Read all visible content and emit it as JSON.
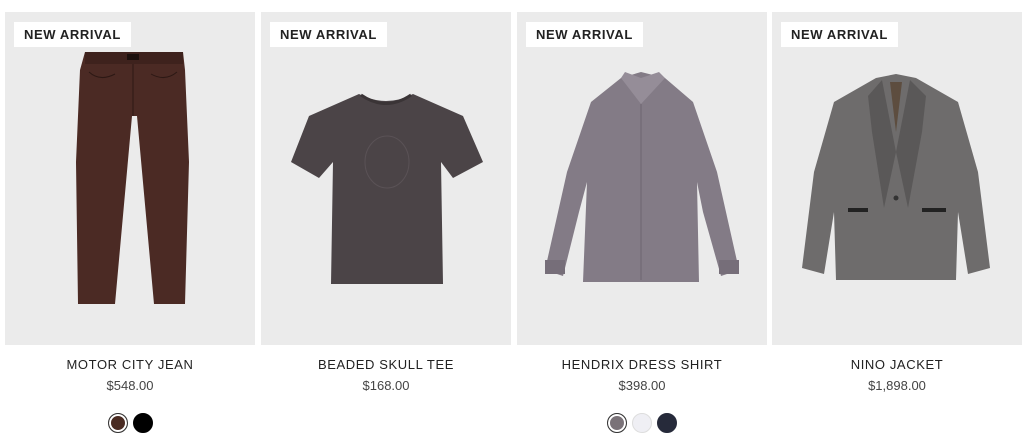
{
  "products": [
    {
      "badge": "NEW ARRIVAL",
      "name": "MOTOR CITY JEAN",
      "price": "$548.00",
      "swatches": [
        {
          "color": "#4a2b22",
          "selected": true
        },
        {
          "color": "#000000",
          "selected": false
        }
      ]
    },
    {
      "badge": "NEW ARRIVAL",
      "name": "BEADED SKULL TEE",
      "price": "$168.00",
      "swatches": []
    },
    {
      "badge": "NEW ARRIVAL",
      "name": "HENDRIX DRESS SHIRT",
      "price": "$398.00",
      "swatches": [
        {
          "color": "#7a7278",
          "selected": true
        },
        {
          "color": "#efeff4",
          "selected": false
        },
        {
          "color": "#262a3a",
          "selected": false
        }
      ]
    },
    {
      "badge": "NEW ARRIVAL",
      "name": "NINO JACKET",
      "price": "$1,898.00",
      "swatches": []
    }
  ]
}
